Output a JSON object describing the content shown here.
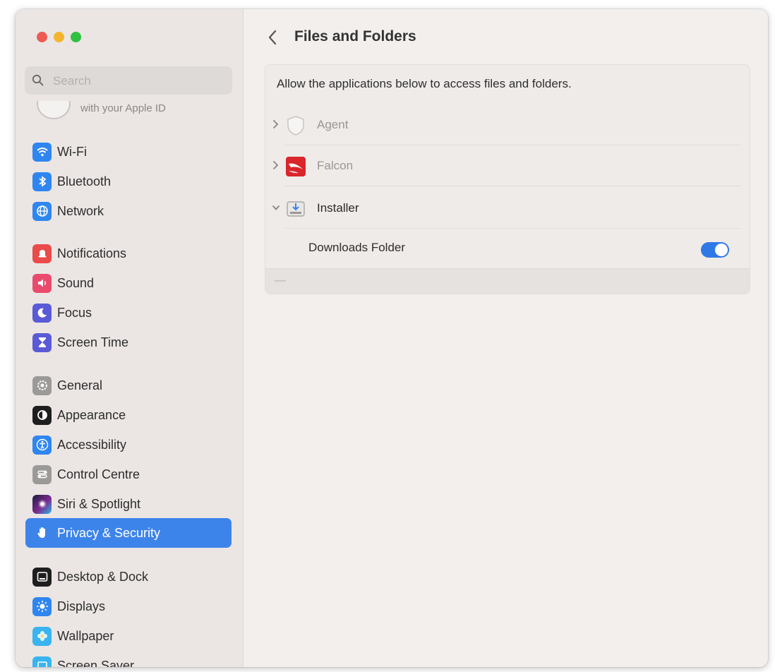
{
  "window": {
    "traffic_lights": [
      "close",
      "minimize",
      "zoom"
    ]
  },
  "search": {
    "placeholder": "Search"
  },
  "apple_id_text": "with your Apple ID",
  "sidebar": {
    "items": [
      {
        "label": "Wi-Fi",
        "icon": "wifi-icon",
        "color": "#2f86f0"
      },
      {
        "label": "Bluetooth",
        "icon": "bluetooth-icon",
        "color": "#2f86f0"
      },
      {
        "label": "Network",
        "icon": "globe-icon",
        "color": "#2f86f0"
      },
      {
        "label": "Notifications",
        "icon": "bell-icon",
        "color": "#ea4b4b"
      },
      {
        "label": "Sound",
        "icon": "speaker-icon",
        "color": "#ea4b6d"
      },
      {
        "label": "Focus",
        "icon": "moon-icon",
        "color": "#5a5ad6"
      },
      {
        "label": "Screen Time",
        "icon": "hourglass-icon",
        "color": "#5a5ad6"
      },
      {
        "label": "General",
        "icon": "gear-icon",
        "color": "#9c9a98"
      },
      {
        "label": "Appearance",
        "icon": "appearance-icon",
        "color": "#1e1e1e"
      },
      {
        "label": "Accessibility",
        "icon": "accessibility-icon",
        "color": "#2f86f0"
      },
      {
        "label": "Control Centre",
        "icon": "control-centre-icon",
        "color": "#9c9a98"
      },
      {
        "label": "Siri & Spotlight",
        "icon": "siri-icon",
        "color": "#1f2a55"
      },
      {
        "label": "Privacy & Security",
        "icon": "hand-icon",
        "color": "#3d84ea",
        "active": true
      },
      {
        "label": "Desktop & Dock",
        "icon": "dock-icon",
        "color": "#1e1e1e"
      },
      {
        "label": "Displays",
        "icon": "sun-icon",
        "color": "#2f86f0"
      },
      {
        "label": "Wallpaper",
        "icon": "flower-icon",
        "color": "#39b4f0"
      },
      {
        "label": "Screen Saver",
        "icon": "screen-saver-icon",
        "color": "#39b4f0"
      }
    ]
  },
  "main": {
    "title": "Files and Folders",
    "description": "Allow the applications below to access files and folders.",
    "apps": [
      {
        "name": "Agent",
        "expanded": false,
        "icon": "shield-icon"
      },
      {
        "name": "Falcon",
        "expanded": false,
        "icon": "falcon-icon"
      },
      {
        "name": "Installer",
        "expanded": true,
        "icon": "installer-icon"
      }
    ],
    "permission": {
      "label": "Downloads Folder",
      "enabled": true
    },
    "footer_minus": "—"
  }
}
